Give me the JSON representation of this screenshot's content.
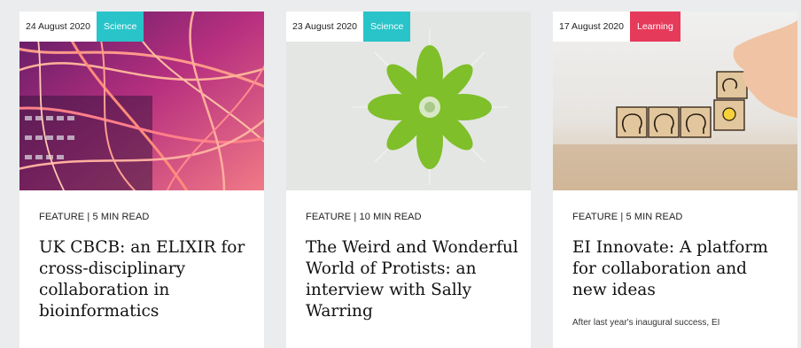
{
  "cards": [
    {
      "date": "24 August 2020",
      "category": "Science",
      "category_color": "#29c4c9",
      "kicker": "FEATURE | 5 MIN READ",
      "title": "UK CBCB: an ELIXIR for cross-disciplinary collaboration in bioinformatics",
      "image_icon": "fibre-optic-cables-image"
    },
    {
      "date": "23 August 2020",
      "category": "Science",
      "category_color": "#29c4c9",
      "kicker": "FEATURE | 10 MIN READ",
      "title": "The Weird and Wonderful World of Protists: an interview with Sally Warring",
      "image_icon": "green-protist-microscopy-image"
    },
    {
      "date": "17 August 2020",
      "category": "Learning",
      "category_color": "#e63a5b",
      "kicker": "FEATURE | 5 MIN READ",
      "title": "EI Innovate: A platform for collaboration and new ideas",
      "excerpt": "After last year's inaugural success, EI",
      "image_icon": "idea-blocks-hand-image"
    }
  ]
}
